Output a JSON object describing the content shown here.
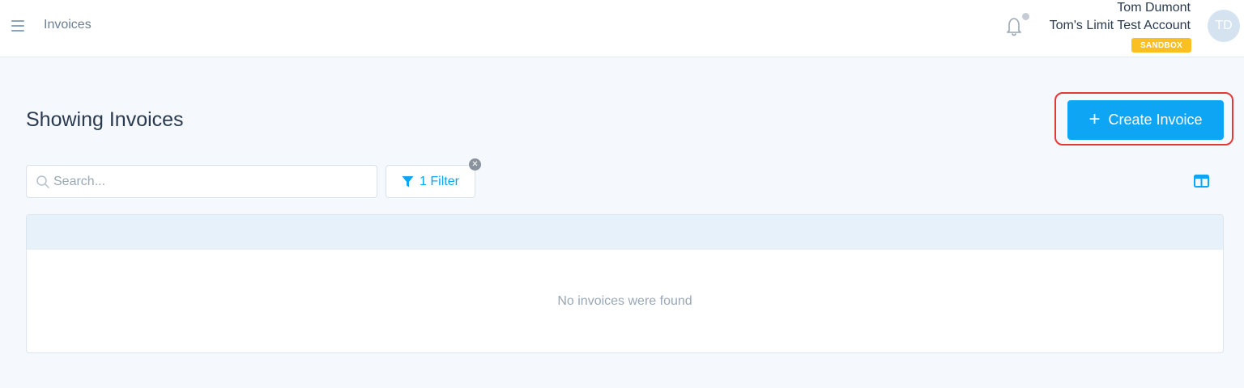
{
  "topbar": {
    "title": "Invoices",
    "user_name": "Tom Dumont",
    "account_name": "Tom's Limit Test Account",
    "env_badge": "SANDBOX",
    "avatar_initials": "TD"
  },
  "page": {
    "title": "Showing Invoices",
    "create_label": "Create Invoice",
    "search_placeholder": "Search...",
    "filter_label": "1 Filter",
    "empty_message": "No invoices were found"
  },
  "icons": {
    "menu": "hamburger-icon",
    "notifications": "bell-icon",
    "search": "search-icon",
    "filter": "funnel-icon",
    "clear_filter": "close-icon",
    "columns": "columns-icon",
    "create": "plus-icon"
  },
  "colors": {
    "accent": "#0ea5f5",
    "badge": "#fbbf24",
    "highlight": "#e53935",
    "background": "#f5f9fd"
  }
}
